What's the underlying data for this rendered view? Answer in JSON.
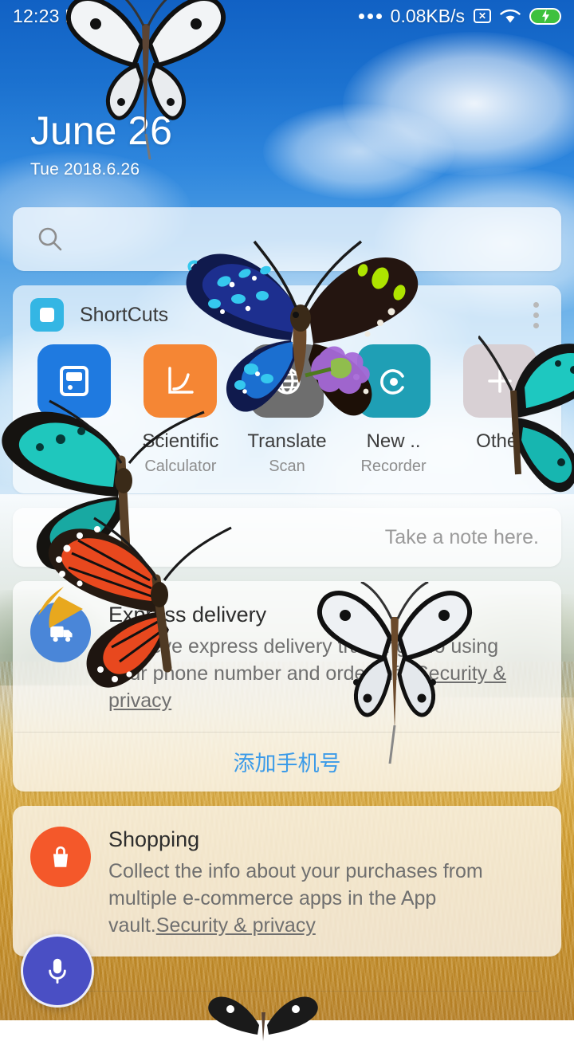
{
  "statusbar": {
    "time": "12:23 PM",
    "network_speed": "0.08KB/s",
    "dots_icon": "overflow-dots-icon",
    "nosim_icon": "no-sim-icon",
    "nosim_glyph": "✕",
    "wifi_icon": "wifi-icon",
    "battery_icon": "battery-charging-icon",
    "battery_color": "#3ec13e"
  },
  "date": {
    "headline": "June 26",
    "subline": "Tue 2018.6.26"
  },
  "search": {
    "value": "",
    "placeholder": "",
    "icon": "search-icon"
  },
  "shortcuts": {
    "title": "ShortCuts",
    "logo_icon": "shortcuts-app-icon",
    "logo_color": "#34b6e4",
    "more_icon": "more-vertical-icon",
    "items": [
      {
        "line1": "",
        "line2": "",
        "icon": "calculator-icon",
        "color": "#1f7ae0"
      },
      {
        "line1": "Scientific",
        "line2": "Calculator",
        "icon": "graph-curve-icon",
        "color": "#f58634"
      },
      {
        "line1": "Translate",
        "line2": "Scan",
        "icon": "globe-icon",
        "color": "#6e6e6e"
      },
      {
        "line1": "New ..",
        "line2": "Recorder",
        "icon": "recorder-icon",
        "color": "#1f9fb5"
      },
      {
        "line1": "Other",
        "line2": "",
        "icon": "plus-icon",
        "color": "#d8d0d4"
      }
    ]
  },
  "note": {
    "placeholder": "Take a note here."
  },
  "express": {
    "title": "Express delivery",
    "icon": "delivery-truck-icon",
    "icon_color": "#4a86d8",
    "desc": "Retrieve express delivery tracking info using your phone number and order info.",
    "link": "Security & privacy",
    "action": "添加手机号",
    "action_color": "#3c9be8"
  },
  "shopping": {
    "title": "Shopping",
    "icon": "shopping-bag-icon",
    "icon_color": "#f4582a",
    "desc": "Collect the info about your purchases from multiple e-commerce apps in the App vault.",
    "link": "Security & privacy"
  },
  "mic": {
    "icon": "microphone-icon",
    "color": "#4a4fc4"
  }
}
